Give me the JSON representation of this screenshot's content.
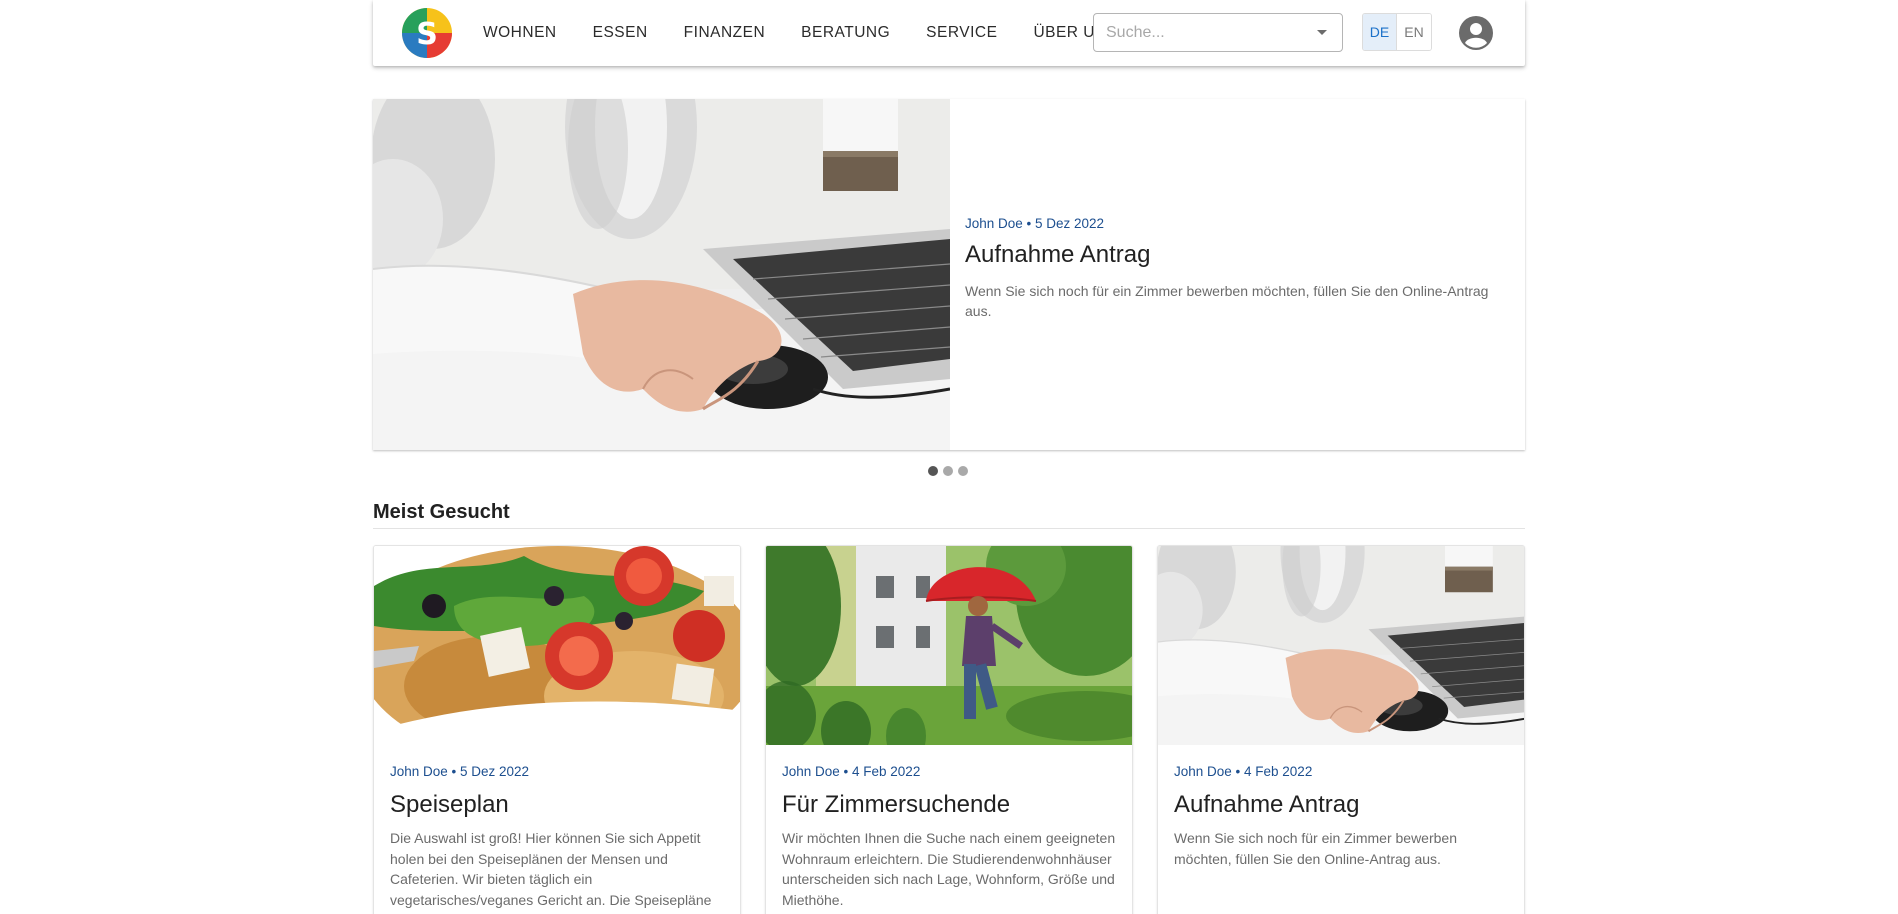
{
  "colors": {
    "meta_blue": "#1d4f8f",
    "lang_active_bg": "#e4eef9",
    "lang_active_text": "#1c71c9",
    "logo_segments": [
      "#f6c21a",
      "#e63c33",
      "#2a7bc0",
      "#27a05b"
    ]
  },
  "header": {
    "logo_icon": "logo-icon",
    "nav": [
      {
        "label": "WOHNEN"
      },
      {
        "label": "ESSEN"
      },
      {
        "label": "FINANZEN"
      },
      {
        "label": "BERATUNG"
      },
      {
        "label": "SERVICE"
      },
      {
        "label": "ÜBER UNS"
      }
    ],
    "search": {
      "placeholder": "Suche...",
      "value": "",
      "icon": "chevron-down-icon"
    },
    "languages": [
      {
        "label": "DE",
        "active": true
      },
      {
        "label": "EN",
        "active": false
      }
    ],
    "account_icon": "account-circle-icon"
  },
  "hero": {
    "author": "John Doe",
    "date": "5 Dez 2022",
    "meta": "John Doe • 5 Dez 2022",
    "title": "Aufnahme Antrag",
    "description": "Wenn Sie sich noch für ein Zimmer bewerben möchten, füllen Sie den Online-Antrag aus.",
    "image": "hand-on-computer-mouse-photo"
  },
  "carousel": {
    "slides": 3,
    "active": 1
  },
  "section": {
    "title": "Meist Gesucht"
  },
  "cards": [
    {
      "meta": "John Doe • 5 Dez 2022",
      "title": "Speiseplan",
      "description": "Die Auswahl ist groß! Hier können Sie sich Appetit holen bei den Speiseplänen der Mensen und Cafeterien. Wir bieten täglich ein vegetarisches/veganes Gericht an. Die Speisepläne",
      "image": "pasta-salad-photo"
    },
    {
      "meta": "John Doe • 4 Feb 2022",
      "title": "Für Zimmersuchende",
      "description": "Wir möchten Ihnen die Suche nach einem geeigneten Wohnraum erleichtern. Die Studierendenwohnhäuser unterscheiden sich nach Lage, Wohnform, Größe und Miethöhe.",
      "image": "woman-with-red-umbrella-photo"
    },
    {
      "meta": "John Doe • 4 Feb 2022",
      "title": "Aufnahme Antrag",
      "description": "Wenn Sie sich noch für ein Zimmer bewerben möchten, füllen Sie den Online-Antrag aus.",
      "image": "hand-on-computer-mouse-photo"
    }
  ]
}
